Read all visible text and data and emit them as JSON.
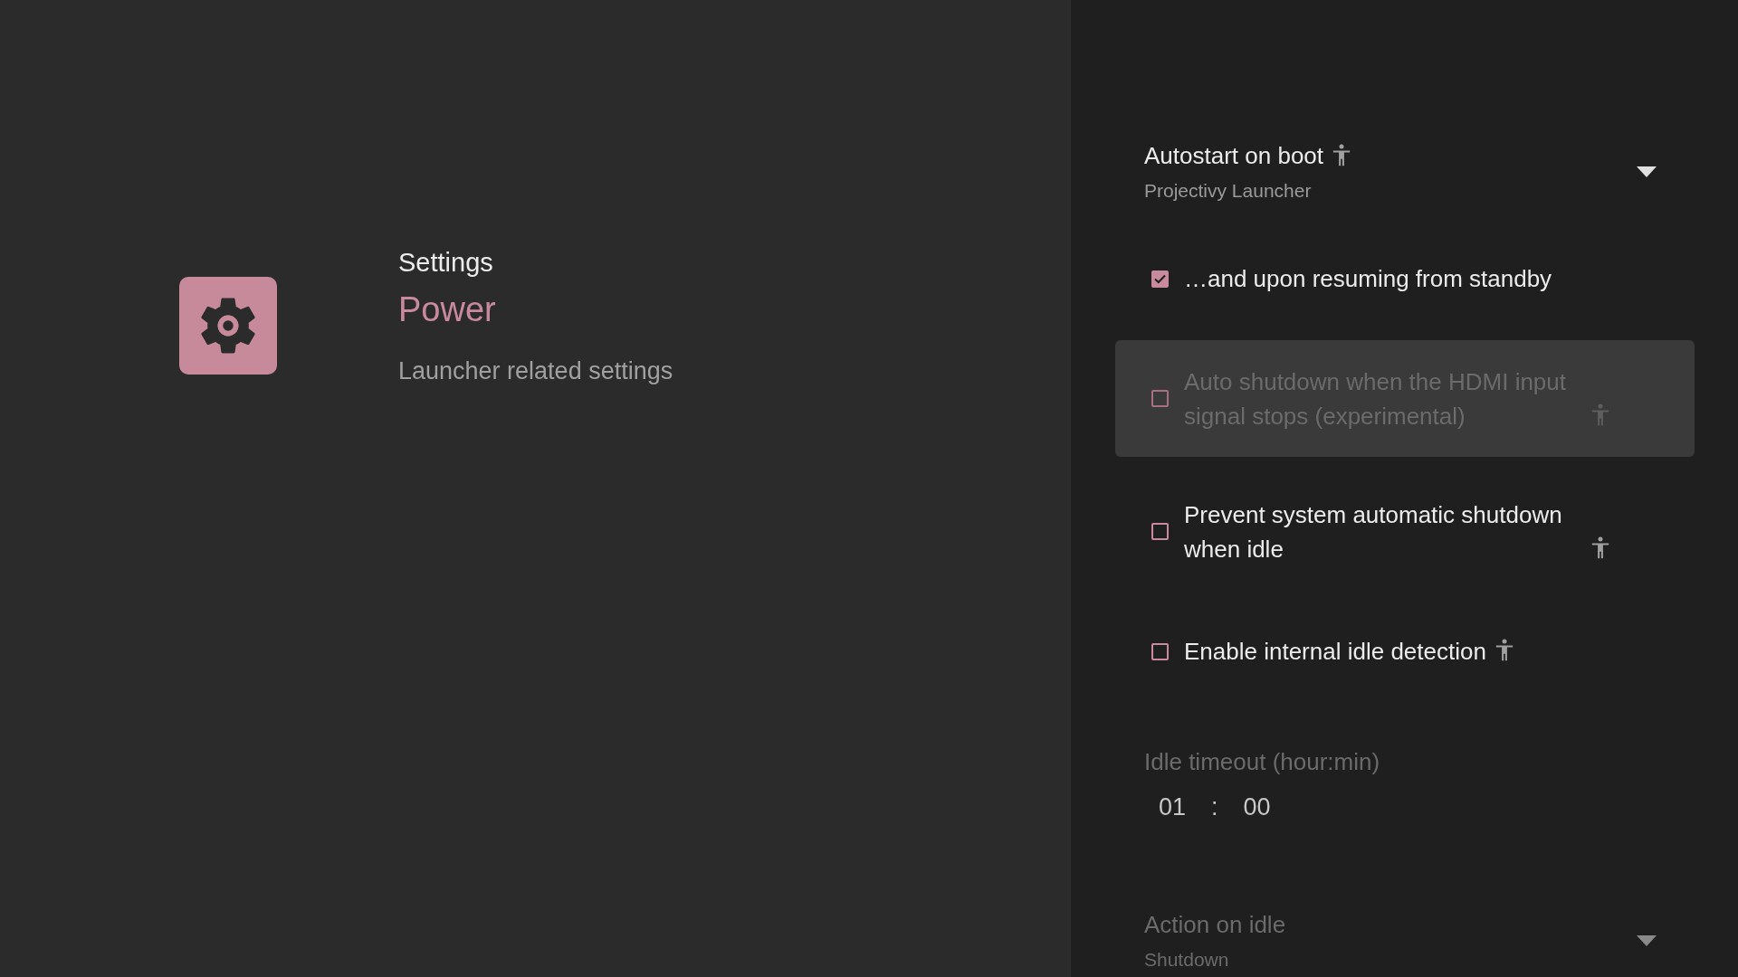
{
  "header": {
    "category": "Settings",
    "title": "Power",
    "description": "Launcher related settings"
  },
  "settings": [
    {
      "kind": "dropdown",
      "label": "Autostart on boot",
      "value": "Projectivy Launcher",
      "accessibility_icon": true,
      "disabled": false,
      "focused": false
    },
    {
      "kind": "checkbox",
      "label": "…and upon resuming from standby",
      "checked": true,
      "accessibility_icon": false,
      "disabled": false,
      "focused": false
    },
    {
      "kind": "checkbox",
      "label": "Auto shutdown when the HDMI input signal stops (experimental)",
      "checked": false,
      "accessibility_icon": true,
      "disabled": true,
      "focused": true
    },
    {
      "kind": "checkbox",
      "label": "Prevent system automatic shutdown when idle",
      "checked": false,
      "accessibility_icon": true,
      "disabled": false,
      "focused": false
    },
    {
      "kind": "checkbox",
      "label": "Enable internal idle detection",
      "checked": false,
      "accessibility_icon": true,
      "disabled": false,
      "focused": false
    },
    {
      "kind": "time",
      "label": "Idle timeout (hour:min)",
      "hours": "01",
      "separator": ":",
      "minutes": "00",
      "disabled": true,
      "focused": false
    },
    {
      "kind": "dropdown",
      "label": "Action on idle",
      "value": "Shutdown",
      "accessibility_icon": false,
      "disabled": true,
      "focused": false
    }
  ]
}
